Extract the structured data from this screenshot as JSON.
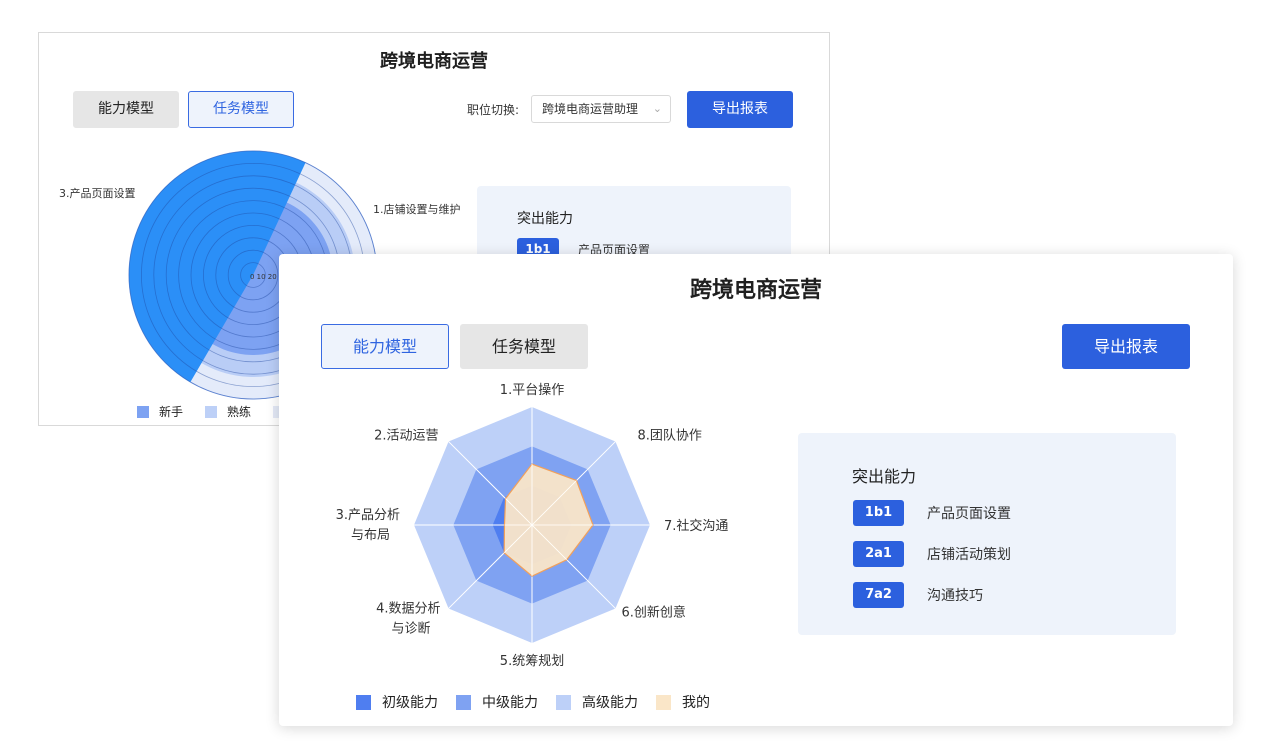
{
  "back_card": {
    "title": "跨境电商运营",
    "tabs": [
      {
        "label": "能力模型",
        "state": "inactive"
      },
      {
        "label": "任务模型",
        "state": "active"
      }
    ],
    "position_label": "职位切换:",
    "position_value": "跨境电商运营助理",
    "export_label": "导出报表",
    "chart_labels": {
      "top_left": "3.产品页面设置",
      "top_right": "1.店铺设置与维护",
      "center_ticks": "0 10 20"
    },
    "panel": {
      "heading": "突出能力",
      "items": [
        {
          "code": "1b1",
          "text": "产品页面设置"
        }
      ]
    },
    "legend": [
      {
        "label": "新手",
        "color": "#7da2f2"
      },
      {
        "label": "熟练",
        "color": "#bdd0f7"
      },
      {
        "label": "",
        "color": "#e3e9f7"
      }
    ]
  },
  "front_card": {
    "title": "跨境电商运营",
    "tabs": [
      {
        "label": "能力模型",
        "state": "active"
      },
      {
        "label": "任务模型",
        "state": "inactive"
      }
    ],
    "export_label": "导出报表",
    "panel": {
      "heading": "突出能力",
      "items": [
        {
          "code": "1b1",
          "text": "产品页面设置"
        },
        {
          "code": "2a1",
          "text": "店铺活动策划"
        },
        {
          "code": "7a2",
          "text": "沟通技巧"
        }
      ]
    },
    "legend": [
      {
        "label": "初级能力",
        "color": "#4f7ef0"
      },
      {
        "label": "中级能力",
        "color": "#7fa2f2"
      },
      {
        "label": "高级能力",
        "color": "#bdd0f8"
      },
      {
        "label": "我的",
        "color": "#fae6c8"
      }
    ]
  },
  "chart_data": [
    {
      "type": "radar",
      "indicators": [
        "1.平台操作",
        "8.团队协作",
        "7.社交沟通",
        "6.创新创意",
        "5.统筹规划",
        "4.数据分析与诊断",
        "3.产品分析与布局",
        "2.活动运营"
      ],
      "max": 3,
      "series": [
        {
          "name": "初级能力",
          "values": [
            1,
            1,
            1,
            1,
            1,
            1,
            1,
            1
          ],
          "color": "#4f7ef0"
        },
        {
          "name": "中级能力",
          "values": [
            2,
            2,
            2,
            2,
            2,
            2,
            2,
            2
          ],
          "color": "#7fa2f2"
        },
        {
          "name": "高级能力",
          "values": [
            3,
            3,
            3,
            3,
            3,
            3,
            3,
            3
          ],
          "color": "#bdd0f8"
        },
        {
          "name": "我的",
          "values": [
            1.55,
            1.6,
            1.55,
            1.25,
            1.3,
            1.0,
            0.7,
            0.95
          ],
          "color": "#fae6c8"
        }
      ]
    }
  ]
}
